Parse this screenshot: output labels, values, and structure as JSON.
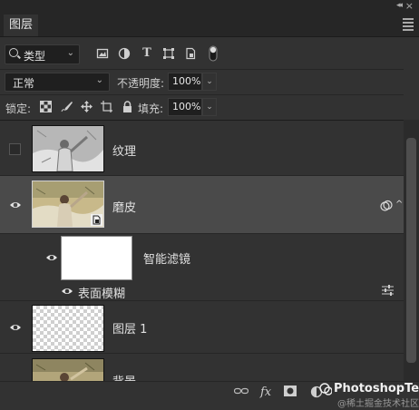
{
  "panel": {
    "title": "图层",
    "collapse_glyph": "◂◂",
    "close_glyph": "×"
  },
  "filter": {
    "kind_label": "类型",
    "icons": [
      "image-filter-icon",
      "adjustment-filter-icon",
      "type-filter-icon",
      "shape-filter-icon",
      "smart-object-filter-icon",
      "filter-toggle-icon"
    ]
  },
  "blend": {
    "mode": "正常",
    "opacity_label": "不透明度:",
    "opacity_value": "100%",
    "fill_label": "填充:",
    "fill_value": "100%"
  },
  "lock": {
    "label": "锁定:",
    "icons": [
      "lock-transparent-icon",
      "lock-paint-icon",
      "lock-position-icon",
      "lock-artboard-icon",
      "lock-all-icon"
    ]
  },
  "layers": [
    {
      "name": "纹理",
      "visible": false,
      "selected": false
    },
    {
      "name": "磨皮",
      "visible": true,
      "selected": true,
      "smart_object": true
    },
    {
      "name": "智能滤镜",
      "visible": true,
      "type": "smart-filter"
    },
    {
      "name": "表面模糊",
      "visible": true,
      "type": "filter-effect"
    },
    {
      "name": "图层 1",
      "visible": true,
      "selected": false
    },
    {
      "name": "背景",
      "visible": true,
      "selected": false
    }
  ],
  "bottom_icons": [
    "link-layers-icon",
    "fx-icon",
    "add-mask-icon",
    "adjustment-layer-icon",
    "group-icon",
    "new-layer-icon",
    "delete-icon"
  ],
  "fx_label": "fx",
  "watermark": {
    "main": "PhotoshopTea",
    "sub": "@稀土掘金技术社区"
  },
  "colors": {
    "panel_bg": "#323232",
    "selected_bg": "#4a4a4a",
    "field_bg": "#1f1f1f"
  }
}
